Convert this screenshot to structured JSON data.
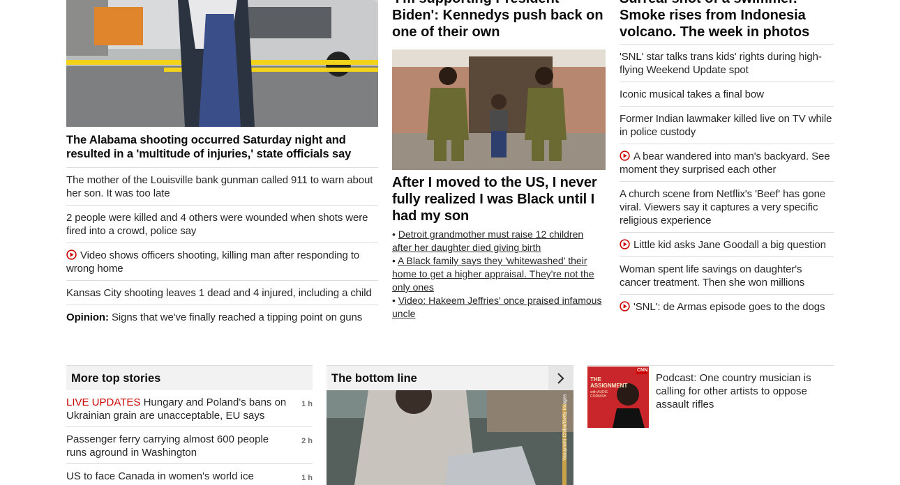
{
  "col1": {
    "headline": "The Alabama shooting occurred Saturday night and resulted in a 'multitude of injuries,' state officials say",
    "stories": [
      {
        "text": "The mother of the Louisville bank gunman called 911 to warn about her son. It was too late",
        "video": false
      },
      {
        "text": "2 people were killed and 4 others were wounded when shots were fired into a crowd, police say",
        "video": false
      },
      {
        "text": "Video shows officers shooting, killing man after responding to wrong home",
        "video": true
      },
      {
        "text": "Kansas City shooting leaves 1 dead and 4 injured, including a child",
        "video": false
      }
    ],
    "opinion_label": "Opinion:",
    "opinion_text": "Signs that we've finally reached a tipping point on guns"
  },
  "col2": {
    "top_headline": "'I'm supporting President Biden': Kennedys push back on one of their own",
    "big_headline": "After I moved to the US, I never fully realized I was Black until I had my son",
    "bullets": [
      "Detroit grandmother must raise 12 children after her daughter died giving birth",
      "A Black family says they 'whitewashed' their home to get a higher appraisal. They're not the only ones",
      "Video: Hakeem Jeffries' once praised infamous uncle"
    ]
  },
  "col3": {
    "top_headline": "Surreal shot of a swimmer. Smoke rises from Indonesia volcano. The week in photos",
    "stories": [
      {
        "text": "'SNL' star talks trans kids' rights during high-flying Weekend Update spot",
        "video": false
      },
      {
        "text": "Iconic musical takes a final bow",
        "video": false
      },
      {
        "text": "Former Indian lawmaker killed live on TV while in police custody",
        "video": false
      },
      {
        "text": "A bear wandered into man's backyard. See moment they surprised each other",
        "video": true
      },
      {
        "text": "A church scene from Netflix's 'Beef' has gone viral. Viewers say it captures a very specific religious experience",
        "video": false
      },
      {
        "text": "Little kid asks Jane Goodall a big question",
        "video": true
      },
      {
        "text": "Woman spent life savings on daughter's cancer treatment. Then she won millions",
        "video": false
      },
      {
        "text": "'SNL': de Armas episode goes to the dogs",
        "video": true
      }
    ]
  },
  "more_top": {
    "title": "More top stories",
    "items": [
      {
        "live": "LIVE UPDATES",
        "text": "Hungary and Poland's bans on Ukrainian grain are unacceptable, EU says",
        "time": "1 h"
      },
      {
        "live": "",
        "text": "Passenger ferry carrying almost 600 people runs aground in Washington",
        "time": "2 h"
      },
      {
        "live": "",
        "text": "US to face Canada in women's world ice",
        "time": "1 h"
      }
    ]
  },
  "bottom_line": {
    "title": "The bottom line",
    "credit": "Yasuyoshi Chiba/Getty Images"
  },
  "podcast": {
    "text": "Podcast: One country musician is calling for other artists to oppose assault rifles",
    "art_logo": "CNN",
    "art_title": "THE ASSIGNMENT",
    "art_sub": "with AUDIE CORNISH"
  },
  "colors": {
    "accent": "#cc0000",
    "divider": "#dcdcdc",
    "panel": "#f2f2f2"
  }
}
